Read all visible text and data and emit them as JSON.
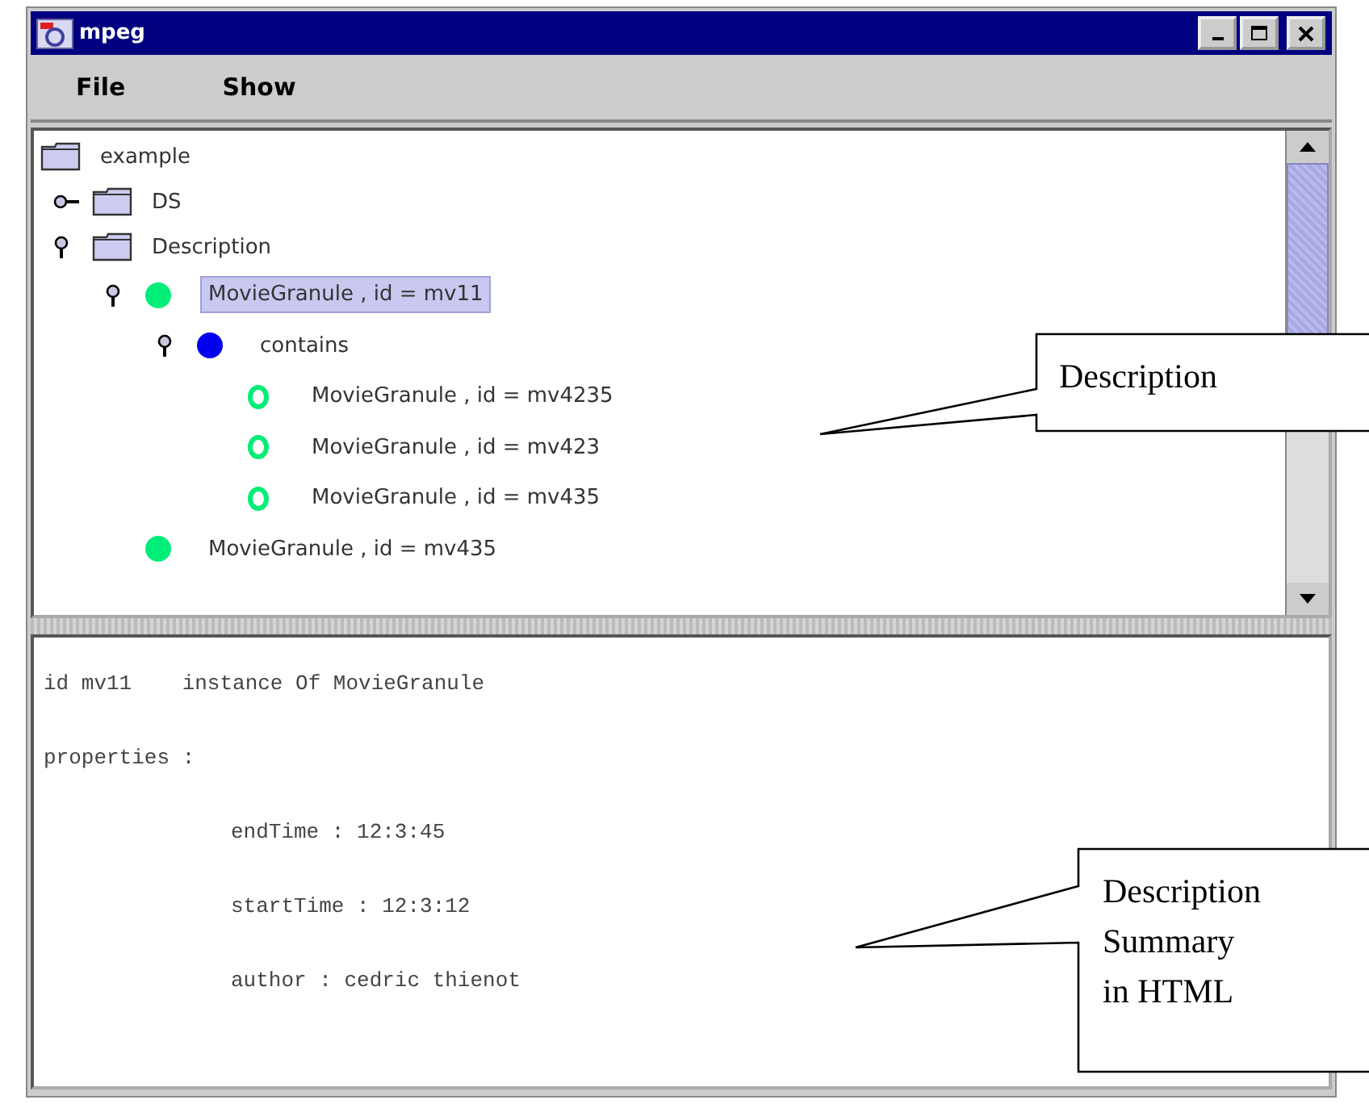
{
  "window": {
    "title": "mpeg"
  },
  "menu": [
    "File",
    "Show"
  ],
  "tree": [
    {
      "label": "example",
      "kind": "folder",
      "selected": false,
      "children": [
        {
          "label": "DS",
          "kind": "folder",
          "expanded": false,
          "selected": false
        },
        {
          "label": "Description",
          "kind": "folder",
          "expanded": true,
          "selected": false,
          "children": [
            {
              "label": "MovieGranule , id = mv11",
              "kind": "dot",
              "color": "#00ee77",
              "expanded": true,
              "selected": true,
              "children": [
                {
                  "label": "contains",
                  "kind": "dot",
                  "color": "#0000ee",
                  "expanded": true,
                  "selected": false,
                  "children": [
                    {
                      "label": "MovieGranule , id = mv4235",
                      "kind": "ring",
                      "color": "#00ee77",
                      "selected": false
                    },
                    {
                      "label": "MovieGranule , id = mv423",
                      "kind": "ring",
                      "color": "#00ee77",
                      "selected": false
                    },
                    {
                      "label": "MovieGranule , id = mv435",
                      "kind": "ring",
                      "color": "#00ee77",
                      "selected": false
                    }
                  ]
                }
              ]
            },
            {
              "label": "MovieGranule , id = mv435",
              "kind": "dot",
              "color": "#00ee77",
              "selected": false
            }
          ]
        }
      ]
    }
  ],
  "summary": {
    "heading": "id mv11    instance Of MovieGranule",
    "properties_label": "properties :",
    "properties": [
      "endTime : 12:3:45",
      "startTime : 12:3:12",
      "author : cedric thienot"
    ]
  },
  "callouts": [
    {
      "lines": [
        "Description"
      ]
    },
    {
      "lines": [
        "Description",
        "Summary",
        "in HTML"
      ]
    }
  ]
}
